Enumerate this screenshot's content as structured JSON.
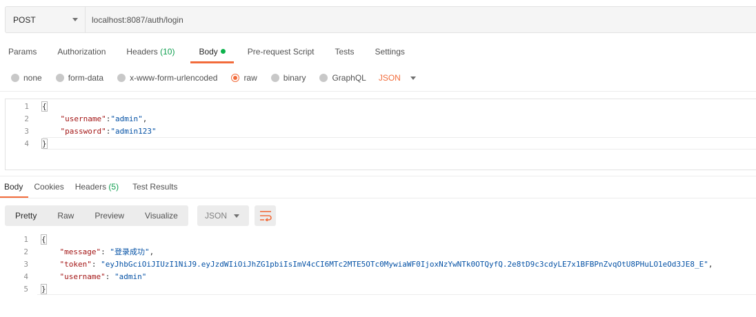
{
  "request": {
    "method": "POST",
    "url": "localhost:8087/auth/login"
  },
  "request_tabs": [
    {
      "label": "Params"
    },
    {
      "label": "Authorization"
    },
    {
      "label": "Headers",
      "count": "(10)"
    },
    {
      "label": "Body"
    },
    {
      "label": "Pre-request Script"
    },
    {
      "label": "Tests"
    },
    {
      "label": "Settings"
    }
  ],
  "body_types": {
    "none": "none",
    "form_data": "form-data",
    "urlencoded": "x-www-form-urlencoded",
    "raw": "raw",
    "binary": "binary",
    "graphql": "GraphQL",
    "format": "JSON",
    "selected": "raw"
  },
  "request_body": {
    "line_numbers": [
      "1",
      "2",
      "3",
      "4"
    ],
    "open_brace": "{",
    "username_key": "\"username\"",
    "username_value": "\"admin\"",
    "password_key": "\"password\"",
    "password_value": "\"admin123\"",
    "close_brace": "}"
  },
  "response_tabs": [
    {
      "label": "Body"
    },
    {
      "label": "Cookies"
    },
    {
      "label": "Headers",
      "count": "(5)"
    },
    {
      "label": "Test Results"
    }
  ],
  "response_toolbar": {
    "views": [
      "Pretty",
      "Raw",
      "Preview",
      "Visualize"
    ],
    "active_view": "Pretty",
    "format": "JSON",
    "wrap_icon": "wrap-lines-icon"
  },
  "response_body": {
    "line_numbers": [
      "1",
      "2",
      "3",
      "4",
      "5"
    ],
    "open_brace": "{",
    "message_key": "\"message\"",
    "message_value": "\"登录成功\"",
    "token_key": "\"token\"",
    "token_value": "\"eyJhbGciOiJIUzI1NiJ9.eyJzdWIiOiJhZG1pbiIsImV4cCI6MTc2MTE5OTc0MywiaWF0IjoxNzYwNTk0OTQyfQ.2e8tD9c3cdyLE7x1BFBPnZvqOtU8PHuLO1eOd3JE8_E\"",
    "username_key": "\"username\"",
    "username_value": "\"admin\"",
    "close_brace": "}"
  },
  "colors": {
    "accent": "#f26b3a",
    "count_green": "#0b9d4c",
    "json_key": "#a31515",
    "json_string": "#0451a5"
  }
}
